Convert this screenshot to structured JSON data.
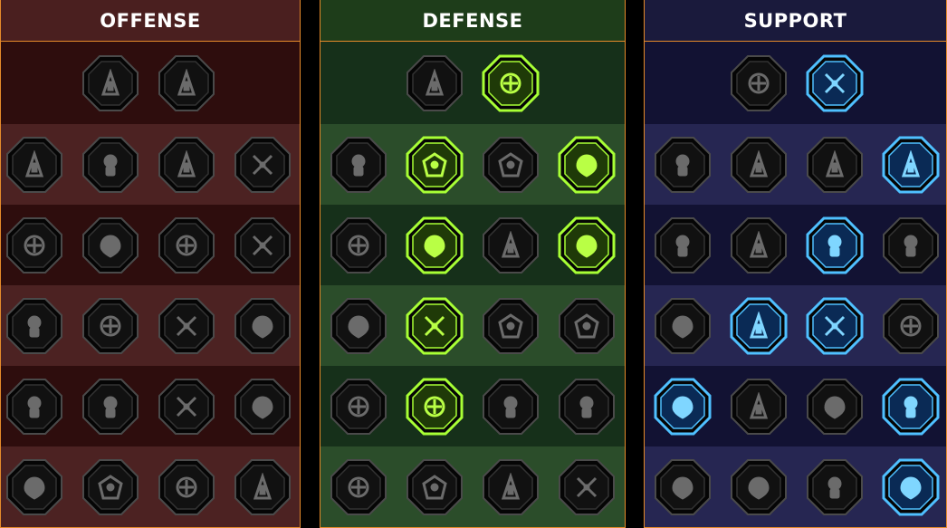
{
  "trees": [
    {
      "title": "OFFENSE",
      "colors": {
        "header": "#4a1f1f",
        "row_dark": "#2e0d0d",
        "row_light": "#4c2222",
        "border": "#e58a2a"
      },
      "rows": [
        [
          {
            "icon": "crossed-swords",
            "active": false
          },
          {
            "icon": "slash-marks",
            "active": false
          }
        ],
        [
          {
            "icon": "horned-demon",
            "active": false
          },
          {
            "icon": "blade-strike",
            "active": false
          },
          {
            "icon": "shield-arrows",
            "active": false
          },
          {
            "icon": "broken-heart",
            "active": false
          }
        ],
        [
          {
            "icon": "archer",
            "active": false
          },
          {
            "icon": "fanged-jaws",
            "active": false
          },
          {
            "icon": "skull-slash",
            "active": false
          },
          {
            "icon": "dagger-hand",
            "active": false
          }
        ],
        [
          {
            "icon": "bleeding-dagger",
            "active": false
          },
          {
            "icon": "iron-fist",
            "active": false
          },
          {
            "icon": "axe",
            "active": false
          },
          {
            "icon": "chained-lightning",
            "active": false
          }
        ],
        [
          {
            "icon": "bombard",
            "active": false
          },
          {
            "icon": "twin-skulls",
            "active": false
          },
          {
            "icon": "sword-circle",
            "active": false
          },
          {
            "icon": "enraged-figure",
            "active": false
          }
        ],
        [
          {
            "icon": "sparkling-sword",
            "active": false
          },
          {
            "icon": "knight-helm",
            "active": false
          },
          {
            "icon": "beast",
            "active": false
          },
          {
            "icon": "spiked-skull",
            "active": false
          }
        ]
      ]
    },
    {
      "title": "DEFENSE",
      "colors": {
        "header": "#1e3d1a",
        "row_dark": "#16301a",
        "row_light": "#2b4d2a",
        "border": "#e58a2a"
      },
      "rows": [
        [
          {
            "icon": "stone-wall",
            "active": false
          },
          {
            "icon": "raised-fist",
            "active": true
          }
        ],
        [
          {
            "icon": "chevron-shield",
            "active": false
          },
          {
            "icon": "heart-organ",
            "active": true
          },
          {
            "icon": "stone-golem",
            "active": false
          },
          {
            "icon": "crossed-blades",
            "active": true
          }
        ],
        [
          {
            "icon": "warrior-stance",
            "active": false
          },
          {
            "icon": "knight-shield",
            "active": true
          },
          {
            "icon": "heart-shield",
            "active": false
          },
          {
            "icon": "halo-figure",
            "active": true
          }
        ],
        [
          {
            "icon": "crowd",
            "active": false
          },
          {
            "icon": "hourglass-skull",
            "active": true
          },
          {
            "icon": "open-hand",
            "active": false
          },
          {
            "icon": "bull-head",
            "active": false
          }
        ],
        [
          {
            "icon": "dash-runner",
            "active": false
          },
          {
            "icon": "flame-spikes",
            "active": true
          },
          {
            "icon": "spiked-skull-ring",
            "active": false
          },
          {
            "icon": "sword-swirl",
            "active": false
          }
        ],
        [
          {
            "icon": "berserker",
            "active": false
          },
          {
            "icon": "winged-shield",
            "active": false
          },
          {
            "icon": "horned-skull",
            "active": false
          },
          {
            "icon": "strong-figure",
            "active": false
          }
        ]
      ]
    },
    {
      "title": "SUPPORT",
      "colors": {
        "header": "#1a1a3c",
        "row_dark": "#121233",
        "row_light": "#262652",
        "border": "#e58a2a"
      },
      "rows": [
        [
          {
            "icon": "heart-sparkle",
            "active": false
          },
          {
            "icon": "energy-rings",
            "active": true
          }
        ],
        [
          {
            "icon": "praying-hands",
            "active": false
          },
          {
            "icon": "layered-shield",
            "active": false
          },
          {
            "icon": "smoking-skull",
            "active": false
          },
          {
            "icon": "speed-blade",
            "active": true
          }
        ],
        [
          {
            "icon": "sparkle-figure",
            "active": false
          },
          {
            "icon": "lightning-shield",
            "active": false
          },
          {
            "icon": "cracked-ground",
            "active": true
          },
          {
            "icon": "shadow-figure",
            "active": false
          }
        ],
        [
          {
            "icon": "chained-heart",
            "active": false
          },
          {
            "icon": "meteor",
            "active": true
          },
          {
            "icon": "open-book",
            "active": true
          },
          {
            "icon": "angry-face",
            "active": false
          }
        ],
        [
          {
            "icon": "compass-star",
            "active": true
          },
          {
            "icon": "boot",
            "active": false
          },
          {
            "icon": "watching-eye",
            "active": false
          },
          {
            "icon": "spirit-dancer",
            "active": true
          }
        ],
        [
          {
            "icon": "potion-flask",
            "active": false
          },
          {
            "icon": "demon-skull",
            "active": false
          },
          {
            "icon": "clenched-gauntlet",
            "active": false
          },
          {
            "icon": "eagle-head",
            "active": true
          }
        ]
      ]
    }
  ],
  "node_colors": {
    "inactive_fill": "#111111",
    "inactive_rim": "#4a4a4a",
    "inactive_glyph": "#6b6b6b",
    "defense_fill": "#1f3a08",
    "defense_rim": "#a8ff35",
    "defense_glyph": "#b9ff45",
    "support_fill": "#0a2a55",
    "support_rim": "#4fc0ff",
    "support_glyph": "#7fd6ff"
  }
}
